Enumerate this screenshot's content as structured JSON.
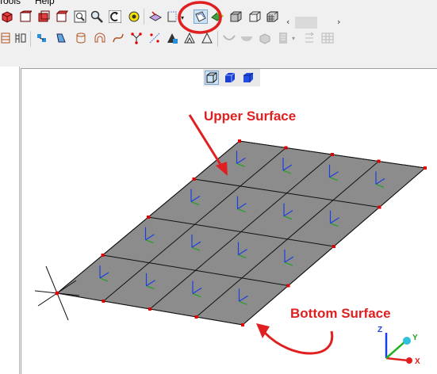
{
  "menu": {
    "tools_label": "Tools",
    "help_label": "Help"
  },
  "annotations": {
    "upper_surface": "Upper Surface",
    "bottom_surface": "Bottom Surface"
  },
  "triad": {
    "x_label": "X",
    "y_label": "Y",
    "z_label": "Z"
  },
  "colors": {
    "annotation_red": "#e02020",
    "mesh_fill": "#8c8c8c",
    "node_red": "#e00000",
    "highlight_blue": "#cde4f7"
  },
  "icons": {
    "toolbar1": [
      "red-cube-icon",
      "red-cube-icon",
      "red-cube-icon",
      "red-cube-icon",
      "red-cube-icon",
      "zoom-box-icon",
      "zoom-icon",
      "rotate-icon",
      "pan-icon",
      "select-icon",
      "plane-icon",
      "surface-select-icon",
      "shaded-icon",
      "hidden-line-icon",
      "wireframe-icon",
      "mesh-icon"
    ],
    "toolbar2": [
      "element-icon",
      "structure-icon",
      "node-icon",
      "shape-icon",
      "volume-icon",
      "arch-icon",
      "curve-icon",
      "vertex-icon",
      "mirror-icon",
      "triangle-fill-icon",
      "triangle-icon",
      "surface-icon",
      "bowl-icon",
      "solid-icon",
      "filter-icon",
      "align-icon",
      "table-icon"
    ],
    "view": [
      "front-view-icon",
      "iso-view-icon",
      "solid-view-icon"
    ]
  }
}
